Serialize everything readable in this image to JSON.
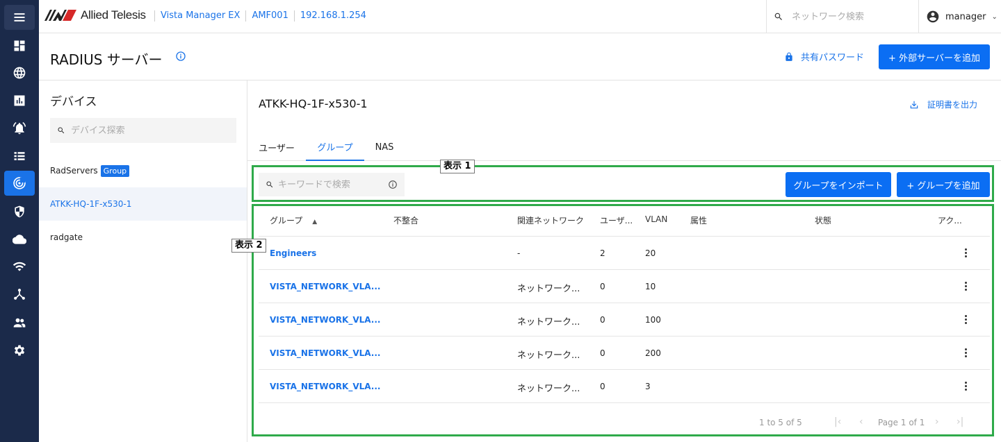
{
  "header": {
    "logo_text": "Allied Telesis",
    "breadcrumbs": [
      "Vista Manager EX",
      "AMF001",
      "192.168.1.254"
    ],
    "search_placeholder": "ネットワーク検索",
    "username": "manager"
  },
  "page": {
    "title": "RADIUS サーバー",
    "shared_password": "共有パスワード",
    "add_external_server": "+ 外部サーバーを追加"
  },
  "devices": {
    "title": "デバイス",
    "search_placeholder": "デバイス探索",
    "items": [
      {
        "name": "RadServers",
        "badge": "Group"
      },
      {
        "name": "ATKK-HQ-1F-x530-1"
      },
      {
        "name": "radgate"
      }
    ]
  },
  "detail": {
    "title": "ATKK-HQ-1F-x530-1",
    "export_cert": "証明書を出力",
    "tabs": [
      "ユーザー",
      "グループ",
      "NAS"
    ],
    "active_tab": "グループ",
    "keyword_placeholder": "キーワードで検索",
    "import_button": "グループをインポート",
    "add_group_button": "+ グループを追加"
  },
  "annotations": {
    "box1": "表示 1",
    "box2": "表示 2"
  },
  "table": {
    "columns": [
      "グループ",
      "不整合",
      "関連ネットワーク",
      "ユーザ...",
      "VLAN",
      "属性",
      "状態",
      "アク..."
    ],
    "sort_indicator": "▲",
    "rows": [
      {
        "group": "Engineers",
        "mismatch": "",
        "network": "-",
        "users": "2",
        "vlan": "20"
      },
      {
        "group": "VISTA_NETWORK_VLA...",
        "mismatch": "",
        "network": "ネットワーク...",
        "users": "0",
        "vlan": "10"
      },
      {
        "group": "VISTA_NETWORK_VLA...",
        "mismatch": "",
        "network": "ネットワーク...",
        "users": "0",
        "vlan": "100"
      },
      {
        "group": "VISTA_NETWORK_VLA...",
        "mismatch": "",
        "network": "ネットワーク...",
        "users": "0",
        "vlan": "200"
      },
      {
        "group": "VISTA_NETWORK_VLA...",
        "mismatch": "",
        "network": "ネットワーク...",
        "users": "0",
        "vlan": "3"
      }
    ]
  },
  "pagination": {
    "range": "1 to 5 of 5",
    "page": "Page 1 of 1"
  },
  "colors": {
    "nav_bg": "#1b2a4a",
    "accent": "#1a73e8",
    "primary_button": "#0b6ef3",
    "highlight_box": "#2faa4a"
  }
}
